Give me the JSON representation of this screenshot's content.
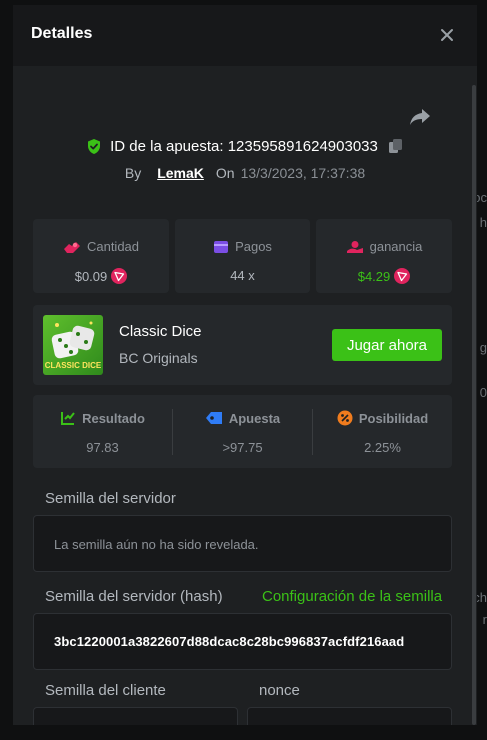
{
  "modal": {
    "title": "Detalles"
  },
  "bet": {
    "id_text": "ID de la apuesta: 123595891624903033",
    "by_label": "By",
    "user": "LemaK",
    "on_label": "On",
    "date": "13/3/2023, 17:37:38"
  },
  "stats": {
    "amount": {
      "label": "Cantidad",
      "value": "$0.09"
    },
    "payout": {
      "label": "Pagos",
      "value": "44 x"
    },
    "profit": {
      "label": "ganancia",
      "value": "$4.29"
    }
  },
  "game": {
    "name": "Classic Dice",
    "provider": "BC Originals",
    "thumb_text": "CLASSIC DICE",
    "play_label": "Jugar ahora"
  },
  "result": {
    "result": {
      "label": "Resultado",
      "value": "97.83"
    },
    "bet": {
      "label": "Apuesta",
      "value": ">97.75"
    },
    "chance": {
      "label": "Posibilidad",
      "value": "2.25%"
    }
  },
  "seeds": {
    "server_label": "Semilla del servidor",
    "server_value": "La semilla aún no ha sido revelada.",
    "hash_label": "Semilla del servidor (hash)",
    "config_link": "Configuración de la semilla",
    "hash_value": "3bc1220001a3822607d88dcac8c28bc996837acfdf216aad",
    "client_label": "Semilla del cliente",
    "nonce_label": "nonce"
  },
  "colors": {
    "accent_green": "#3bc117",
    "modal_bg": "#1e2022",
    "card_bg": "#25282b",
    "tron_red": "#e0245e"
  },
  "icons": [
    "close-icon",
    "share-icon",
    "shield-check-icon",
    "copy-icon",
    "wager-icon",
    "wallet-icon",
    "profit-icon",
    "tron-coin-icon",
    "result-icon",
    "bet-tag-icon",
    "chance-icon"
  ]
}
